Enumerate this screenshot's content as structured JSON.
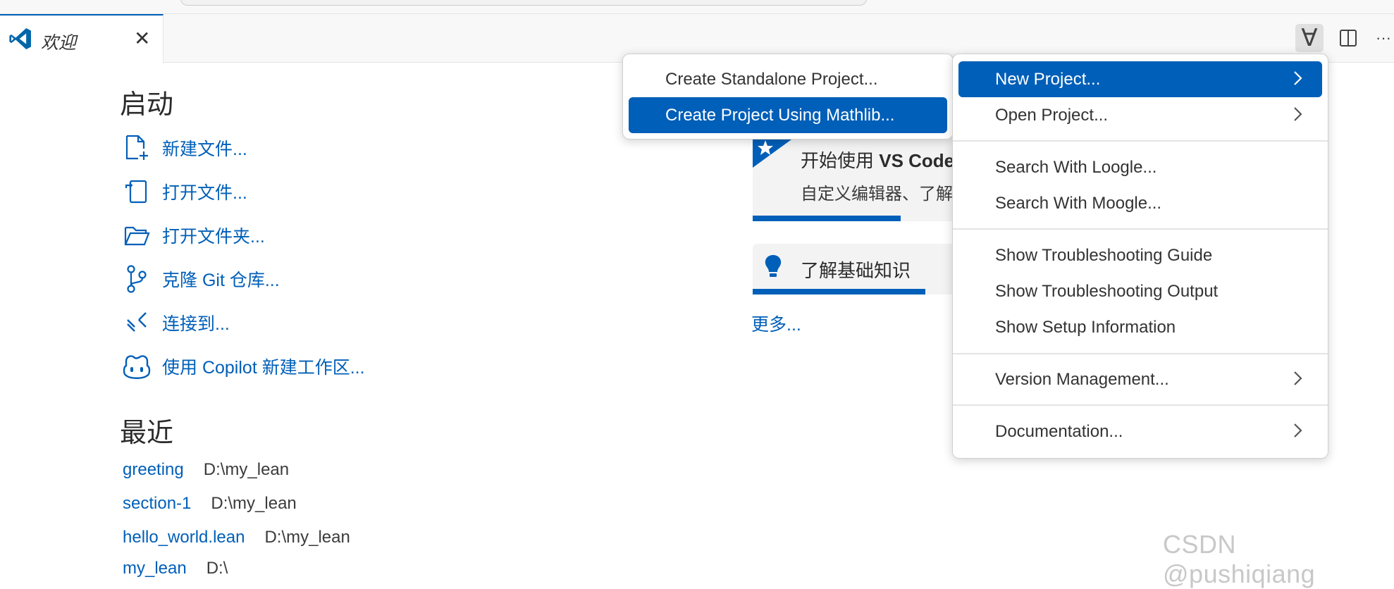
{
  "tab": {
    "title": "欢迎",
    "close": "✕"
  },
  "toolbar": {
    "lean_symbol": "∀",
    "more": "···"
  },
  "start": {
    "heading": "启动",
    "items": [
      {
        "label": "新建文件..."
      },
      {
        "label": "打开文件..."
      },
      {
        "label": "打开文件夹..."
      },
      {
        "label": "克隆 Git 仓库..."
      },
      {
        "label": "连接到..."
      },
      {
        "label": "使用 Copilot 新建工作区..."
      }
    ]
  },
  "recent": {
    "heading": "最近",
    "items": [
      {
        "name": "greeting",
        "path": "D:\\my_lean"
      },
      {
        "name": "section-1",
        "path": "D:\\my_lean"
      },
      {
        "name": "hello_world.lean",
        "path": "D:\\my_lean"
      },
      {
        "name": "my_lean",
        "path": "D:\\"
      }
    ]
  },
  "walkthroughs": {
    "get_started_title_prefix": "开始使用 ",
    "get_started_title_bold": "VS Code",
    "get_started_desc": "自定义编辑器、了解",
    "learn_basics": "了解基础知识",
    "more": "更多..."
  },
  "submenu": {
    "items": [
      {
        "label": "Create Standalone Project..."
      },
      {
        "label": "Create Project Using Mathlib..."
      }
    ]
  },
  "lean_menu": {
    "items": [
      {
        "label": "New Project..."
      },
      {
        "label": "Open Project..."
      },
      {
        "label": "Search With Loogle..."
      },
      {
        "label": "Search With Moogle..."
      },
      {
        "label": "Show Troubleshooting Guide"
      },
      {
        "label": "Show Troubleshooting Output"
      },
      {
        "label": "Show Setup Information"
      },
      {
        "label": "Version Management..."
      },
      {
        "label": "Documentation..."
      }
    ]
  },
  "watermark": "CSDN @pushiqiang",
  "colors": {
    "accent": "#005fb8",
    "menu_selected": "#005fb8",
    "link": "#005fb8"
  }
}
